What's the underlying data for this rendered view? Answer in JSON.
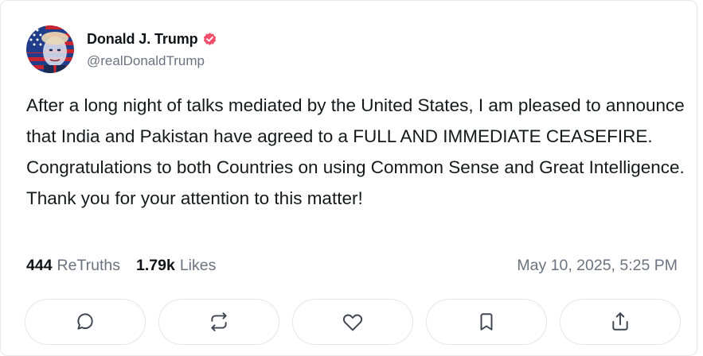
{
  "post": {
    "author": {
      "display_name": "Donald J. Trump",
      "handle": "@realDonaldTrump",
      "verified": true,
      "verified_color": "#f04e6a",
      "avatar_icon": "avatar-flag-portrait-icon"
    },
    "text": "After a long night of talks mediated by the United States, I am pleased to announce that India and Pakistan have agreed to a FULL AND IMMEDIATE CEASEFIRE. Congratulations to both Countries on using Common Sense and Great Intelligence. Thank you for your attention to this matter!",
    "stats": {
      "retruths_count": "444",
      "retruths_label": "ReTruths",
      "likes_count": "1.79k",
      "likes_label": "Likes"
    },
    "timestamp": "May 10, 2025, 5:25 PM"
  },
  "actions": [
    {
      "name": "reply",
      "icon": "comment-bubble-icon"
    },
    {
      "name": "retruth",
      "icon": "repost-arrows-icon"
    },
    {
      "name": "like",
      "icon": "heart-icon"
    },
    {
      "name": "bookmark",
      "icon": "bookmark-icon"
    },
    {
      "name": "share",
      "icon": "share-upload-icon"
    }
  ],
  "colors": {
    "text_primary": "#0f1419",
    "text_secondary": "#6b7280",
    "border": "#e3e5e8"
  }
}
